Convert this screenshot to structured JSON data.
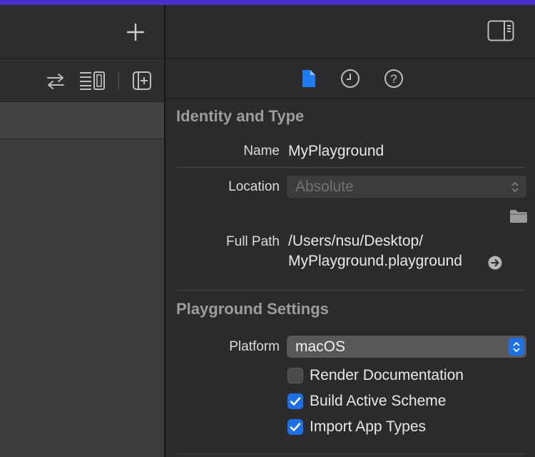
{
  "inspector": {
    "identity": {
      "title": "Identity and Type",
      "name_label": "Name",
      "name_value": "MyPlayground",
      "location_label": "Location",
      "location_value": "Absolute",
      "fullpath_label": "Full Path",
      "fullpath_line1": "/Users/nsu/Desktop/",
      "fullpath_line2": "MyPlayground.playground"
    },
    "playground": {
      "title": "Playground Settings",
      "platform_label": "Platform",
      "platform_value": "macOS",
      "checkboxes": [
        {
          "label": "Render Documentation",
          "checked": false
        },
        {
          "label": "Build Active Scheme",
          "checked": true
        },
        {
          "label": "Import App Types",
          "checked": true
        }
      ]
    }
  },
  "colors": {
    "accent": "#1e6fe6",
    "window_top": "#4a2fc8",
    "panel_bg": "#2b2b2d"
  },
  "icons": [
    "plus-icon",
    "swap-icon",
    "editor-layout-icon",
    "add-editor-icon",
    "toggle-inspector-icon",
    "file-inspector-icon",
    "history-inspector-icon",
    "help-inspector-icon",
    "folder-icon",
    "arrow-circle-icon",
    "select-chevron-icon"
  ]
}
